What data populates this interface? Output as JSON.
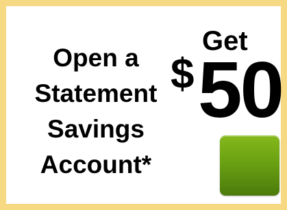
{
  "ad": {
    "headline_lines": [
      "Open a",
      "Statement",
      "Savings",
      "Account*"
    ],
    "offer_prefix": "Get",
    "currency_symbol": "$",
    "offer_amount": "50"
  },
  "colors": {
    "border": "#f7d983",
    "text": "#000000",
    "button_top": "#85b81c",
    "button_bottom": "#4c7a0c"
  }
}
